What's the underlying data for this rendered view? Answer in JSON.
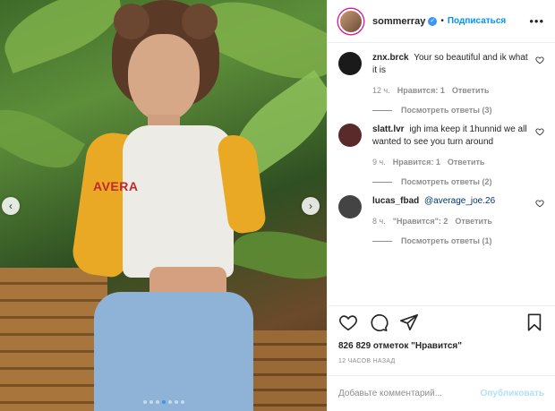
{
  "post": {
    "author": "sommerray",
    "follow_label": "Подписаться",
    "separator": "•",
    "more_label": "•••"
  },
  "media": {
    "shirt_text": "AVERA",
    "carousel_dots": 7,
    "active_dot": 3
  },
  "comments": [
    {
      "user": "znx.brck",
      "text": "Your so beautiful and ik what it is",
      "time": "12 ч.",
      "likes": "Нравится: 1",
      "reply": "Ответить",
      "replies": "Посмотреть ответы (3)",
      "avatar_color": "#1a1a1a"
    },
    {
      "user": "slatt.lvr",
      "text": "igh ima keep it 1hunnid we all wanted to see you turn around",
      "time": "9 ч.",
      "likes": "Нравится: 1",
      "reply": "Ответить",
      "replies": "Посмотреть ответы (2)",
      "avatar_color": "#5a2a2a"
    },
    {
      "user": "lucas_fbad",
      "mention": "@average_joe.26",
      "text": "",
      "time": "8 ч.",
      "likes": "\"Нравится\": 2",
      "reply": "Ответить",
      "replies": "Посмотреть ответы (1)",
      "avatar_color": "#444444"
    }
  ],
  "engagement": {
    "likes_text": "826 829 отметок \"Нравится\"",
    "posted_ago": "12 ЧАСОВ НАЗАД"
  },
  "composer": {
    "placeholder": "Добавьте комментарий...",
    "publish_label": "Опубликовать"
  },
  "colors": {
    "accent": "#0095f6",
    "verified": "#3897f0",
    "publish_disabled": "#b2dffc"
  }
}
